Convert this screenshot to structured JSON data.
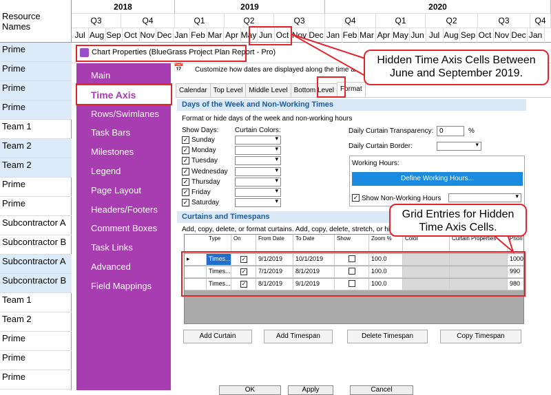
{
  "timeline": {
    "corner_label": "Resource Names",
    "years": [
      "2018",
      "2019",
      "2020"
    ],
    "quarters": [
      "Q3",
      "Q4",
      "Q1",
      "Q2",
      "Q3",
      "Q4",
      "Q1",
      "Q2",
      "Q3",
      "Q4"
    ],
    "months": [
      "Jul",
      "Aug",
      "Sep",
      "Oct",
      "Nov",
      "Dec",
      "Jan",
      "Feb",
      "Mar",
      "Apr",
      "May",
      "Jun",
      "Oct",
      "Nov",
      "Dec",
      "Jan",
      "Feb",
      "Mar",
      "Apr",
      "May",
      "Jun",
      "Jul",
      "Aug",
      "Sep",
      "Oct",
      "Nov",
      "Dec",
      "Jan"
    ],
    "resources": [
      "Prime",
      "Prime",
      "Prime",
      "Prime",
      "Team 1",
      "Team 2",
      "Team 2",
      "Prime",
      "Prime",
      "Subcontractor A",
      "Subcontractor B",
      "Subcontractor A",
      "Subcontractor B",
      "Team 1",
      "Team 2",
      "Prime",
      "Prime",
      "Prime"
    ]
  },
  "dialog": {
    "title": "Chart Properties (BlueGrass Project Plan Report - Pro)",
    "description": "Customize how dates are displayed along the time axis.",
    "sidebar": [
      "Main",
      "Time Axis",
      "Rows/Swimlanes",
      "Task Bars",
      "Milestones",
      "Legend",
      "Page Layout",
      "Headers/Footers",
      "Comment Boxes",
      "Task Links",
      "Advanced",
      "Field Mappings"
    ],
    "tabs": [
      "Calendar",
      "Top Level",
      "Middle Level",
      "Bottom Level",
      "Format"
    ],
    "days_section": {
      "header": "Days of the Week and Non-Working Times",
      "subtitle": "Format or hide days of the week and non-working hours",
      "show_days_label": "Show Days:",
      "curtain_colors_label": "Curtain Colors:",
      "days": [
        "Sunday",
        "Monday",
        "Tuesday",
        "Wednesday",
        "Thursday",
        "Friday",
        "Saturday"
      ],
      "transparency_label": "Daily Curtain Transparency:",
      "transparency_value": "0",
      "percent": "%",
      "border_label": "Daily Curtain Border:",
      "working_hours_label": "Working Hours:",
      "define_button": "Define Working Hours...",
      "show_nonworking": "Show Non-Working Hours"
    },
    "curtains_section": {
      "header": "Curtains and Timespans",
      "subtitle": "Add, copy, delete, or format curtains.  Add, copy, delete, stretch, or hid",
      "columns": [
        "Type",
        "On",
        "From Date",
        "To Date",
        "Show",
        "Zoom %",
        "Color",
        "Curtain Properties",
        "Priori"
      ],
      "rows": [
        {
          "type": "Times...",
          "from": "9/1/2019",
          "to": "10/1/2019",
          "zoom": "100.0",
          "priority": "1000"
        },
        {
          "type": "Times...",
          "from": "7/1/2019",
          "to": "8/1/2019",
          "zoom": "100.0",
          "priority": "990"
        },
        {
          "type": "Times...",
          "from": "8/1/2019",
          "to": "9/1/2019",
          "zoom": "100.0",
          "priority": "980"
        }
      ],
      "buttons": [
        "Add Curtain",
        "Add Timespan",
        "Delete Timespan",
        "Copy Timespan"
      ]
    },
    "footer_buttons": [
      "OK",
      "Apply",
      "Cancel"
    ]
  },
  "annotations": {
    "callout_top": "Hidden Time Axis Cells Between June and September 2019.",
    "callout_bottom": "Grid Entries for Hidden Time Axis Cells."
  }
}
